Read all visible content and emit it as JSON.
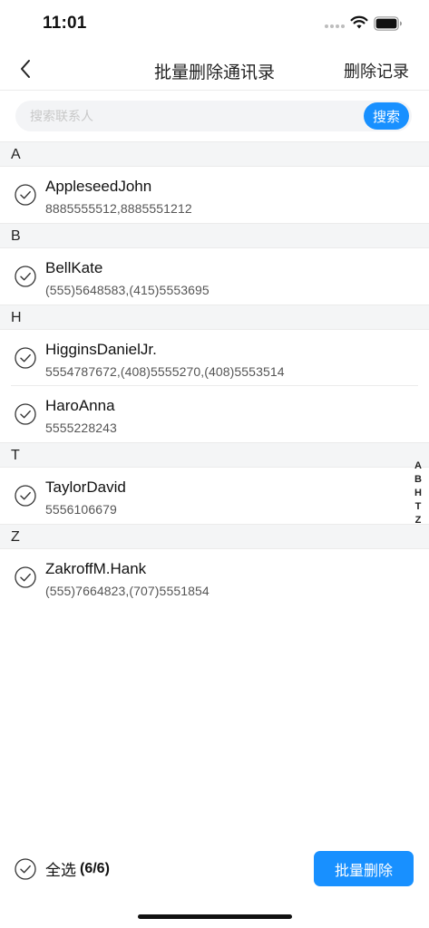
{
  "status_bar": {
    "time": "11:01",
    "icons": [
      "cellular-signal-icon",
      "wifi-icon",
      "battery-icon"
    ]
  },
  "nav": {
    "back_icon": "chevron-left-icon",
    "title": "批量删除通讯录",
    "right_action": "删除记录"
  },
  "search": {
    "placeholder": "搜索联系人",
    "value": "",
    "button_label": "搜索"
  },
  "sections": [
    {
      "letter": "A",
      "contacts": [
        {
          "name": "AppleseedJohn",
          "phone": "8885555512,8885551212",
          "checked": true
        }
      ]
    },
    {
      "letter": "B",
      "contacts": [
        {
          "name": "BellKate",
          "phone": "(555)5648583,(415)5553695",
          "checked": true
        }
      ]
    },
    {
      "letter": "H",
      "contacts": [
        {
          "name": "HigginsDanielJr.",
          "phone": "5554787672,(408)5555270,(408)5553514",
          "checked": true
        },
        {
          "name": "HaroAnna",
          "phone": "5555228243",
          "checked": true
        }
      ]
    },
    {
      "letter": "T",
      "contacts": [
        {
          "name": "TaylorDavid",
          "phone": "5556106679",
          "checked": true
        }
      ]
    },
    {
      "letter": "Z",
      "contacts": [
        {
          "name": "ZakroffM.Hank",
          "phone": "(555)7664823,(707)5551854",
          "checked": true
        }
      ]
    }
  ],
  "index_bar": [
    "A",
    "B",
    "H",
    "T",
    "Z"
  ],
  "bottom": {
    "select_all_label": "全选",
    "select_all_count": "(6/6)",
    "batch_delete_label": "批量删除"
  },
  "colors": {
    "accent": "#1890ff",
    "section_bg": "#f4f5f6",
    "divider": "#ebebeb"
  }
}
